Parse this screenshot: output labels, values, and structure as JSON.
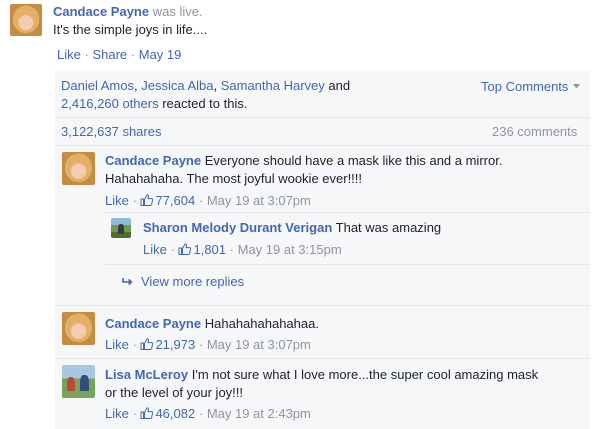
{
  "post": {
    "author": "Candace Payne",
    "status": "was live.",
    "text": "It's the simple joys in life....",
    "like_label": "Like",
    "share_label": "Share",
    "date": "May 19"
  },
  "reactions": {
    "names": [
      "Daniel Amos",
      "Jessica Alba",
      "Samantha Harvey"
    ],
    "and_text": "and",
    "others": "2,416,260 others",
    "suffix": "reacted to this.",
    "top_comments": "Top Comments",
    "shares": "3,122,637 shares",
    "comments_count": "236 comments"
  },
  "comments": [
    {
      "author": "Candace Payne",
      "line1": "Everyone should have a mask like this and a mirror.",
      "line2": "Hahahahaha. The most joyful wookie ever!!!!",
      "like_label": "Like",
      "likes": "77,604",
      "time": "May 19 at 3:07pm",
      "reply": {
        "author": "Sharon Melody Durant Verigan",
        "text": "That was amazing",
        "like_label": "Like",
        "likes": "1,801",
        "time": "May 19 at 3:15pm"
      },
      "view_more": "View more replies"
    },
    {
      "author": "Candace Payne",
      "line1": "Hahahahahahahaa.",
      "like_label": "Like",
      "likes": "21,973",
      "time": "May 19 at 3:07pm"
    },
    {
      "author": "Lisa McLeroy",
      "line1": "I'm not sure what I love more...the super cool amazing mask",
      "line2": "or the level of your joy!!!",
      "like_label": "Like",
      "likes": "46,082",
      "time": "May 19 at 2:43pm"
    }
  ],
  "colors": {
    "link": "#4267b2",
    "muted": "#90949c",
    "panel": "#f6f7f9"
  },
  "icons": [
    "thumbs-up-icon",
    "reply-arrow-icon",
    "caret-down-icon"
  ]
}
